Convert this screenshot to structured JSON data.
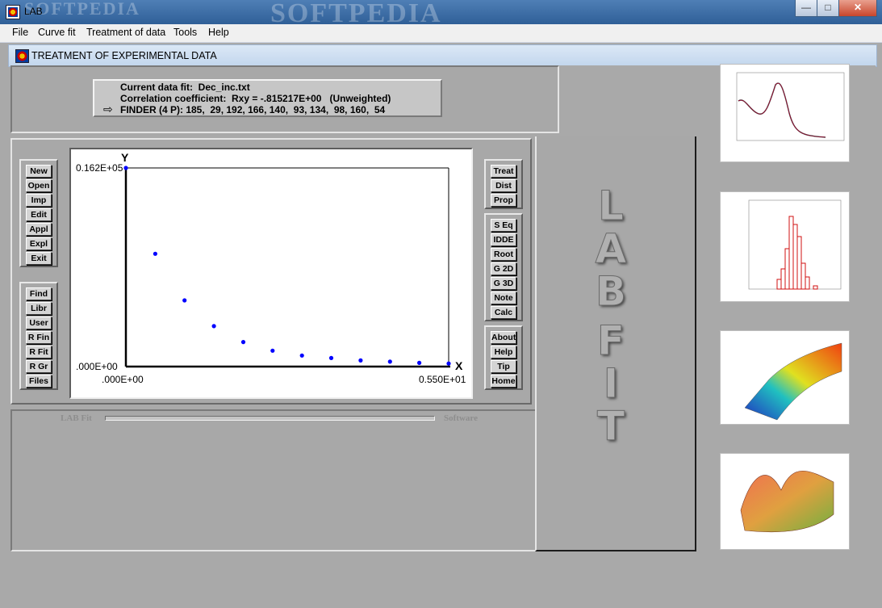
{
  "window": {
    "title": "LAB",
    "watermark_left": "SOFTPEDIA",
    "watermark_center": "SOFTPEDIA",
    "minimize_glyph": "—",
    "maximize_glyph": "□",
    "close_glyph": "✕"
  },
  "menu": [
    "File",
    "Curve fit",
    "Treatment of data",
    "Tools",
    "Help"
  ],
  "child_window": {
    "title": "TREATMENT OF EXPERIMENTAL DATA"
  },
  "info": {
    "line1": "Current data fit:  Dec_inc.txt",
    "line2": "Correlation coefficient:  Rxy = -.815217E+00   (Unweighted)",
    "line3": "FINDER (4 P): 185,  29, 192, 166, 140,  93, 134,  98, 160,  54"
  },
  "left_buttons_group1": [
    "New",
    "Open",
    "Imp",
    "Edit",
    "Appl",
    "Expl",
    "Exit"
  ],
  "left_buttons_group2": [
    "Find",
    "Libr",
    "User",
    "R Fin",
    "R Fit",
    "R Gr",
    "Files"
  ],
  "right_buttons_group1": [
    "Treat",
    "Dist",
    "Prop"
  ],
  "right_buttons_group2": [
    "S Eq",
    "IDDE",
    "Root",
    "G 2D",
    "G 3D",
    "Note",
    "Calc"
  ],
  "right_buttons_group3": [
    "About",
    "Help",
    "Tip",
    "Home"
  ],
  "progress": {
    "left_text": "LAB Fit",
    "right_text": "Software"
  },
  "logo_letters": [
    "L",
    "A",
    "B",
    "F",
    "I",
    "T"
  ],
  "chart_data": {
    "type": "scatter",
    "title": "",
    "xlabel": "X",
    "ylabel": "Y",
    "x_tick_labels": [
      ".000E+00",
      "0.550E+01"
    ],
    "y_tick_labels": [
      ".000E+00",
      "0.162E+05"
    ],
    "xlim": [
      0,
      5.5
    ],
    "ylim": [
      0,
      16200
    ],
    "grid": false,
    "point_color": "#0000ff",
    "series": [
      {
        "x": [
          0.0,
          0.5,
          1.0,
          1.5,
          2.0,
          2.5,
          3.0,
          3.5,
          4.0,
          4.5,
          5.0,
          5.5
        ],
        "y": [
          16200,
          9200,
          5400,
          3300,
          2000,
          1300,
          900,
          700,
          500,
          400,
          300,
          250
        ]
      }
    ]
  }
}
